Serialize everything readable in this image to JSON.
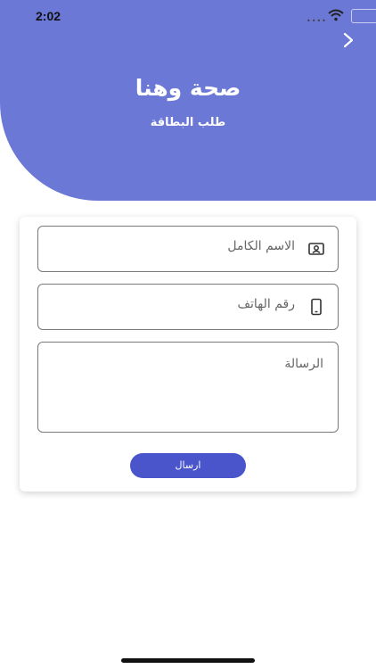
{
  "status_bar": {
    "time": "2:02"
  },
  "header": {
    "title": "صحة وهنا",
    "subtitle": "طلب البطاقة"
  },
  "form": {
    "name_placeholder": "الاسم الكامل",
    "phone_placeholder": "رقم الهاتف",
    "message_placeholder": "الرسالة",
    "submit_label": "ارسال"
  },
  "colors": {
    "header_bg": "#6b78d6",
    "button_bg": "#4a55cc"
  }
}
